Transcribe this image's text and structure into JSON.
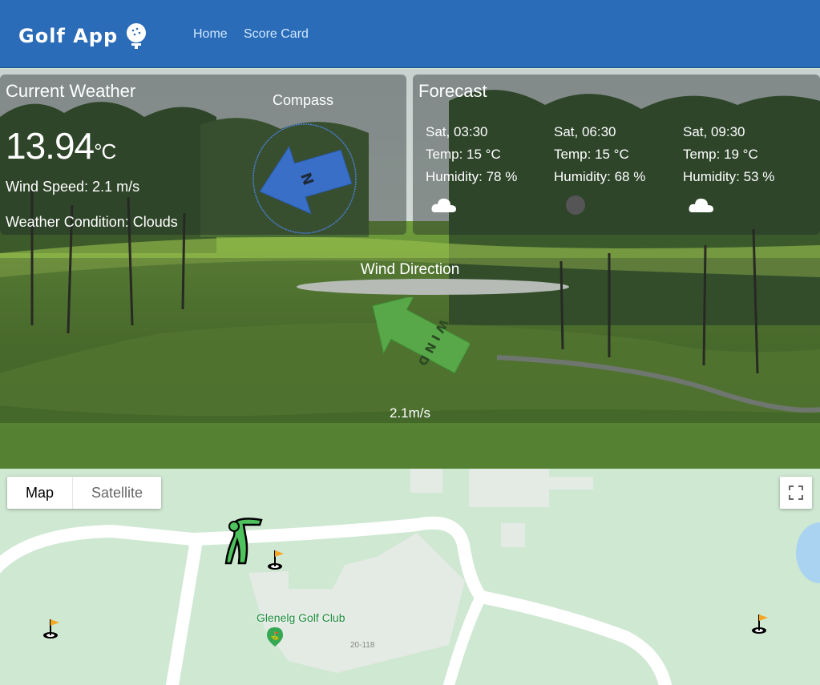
{
  "navbar": {
    "brand": "Golf App",
    "links": [
      {
        "label": "Home"
      },
      {
        "label": "Score Card"
      }
    ]
  },
  "weather": {
    "title": "Current Weather",
    "temp_value": "13.94",
    "temp_unit": "°C",
    "wind_speed": "Wind Speed: 2.1 m/s",
    "condition": "Weather Condition: Clouds",
    "compass_label": "Compass",
    "compass_letter": "N"
  },
  "forecast": {
    "title": "Forecast",
    "items": [
      {
        "time": "Sat, 03:30",
        "temp": "Temp: 15 °C",
        "humidity": "Humidity: 78 %",
        "icon": "cloud-icon"
      },
      {
        "time": "Sat, 06:30",
        "temp": "Temp: 15 °C",
        "humidity": "Humidity: 68 %",
        "icon": "dark-cloud-icon"
      },
      {
        "time": "Sat, 09:30",
        "temp": "Temp: 19 °C",
        "humidity": "Humidity: 53 %",
        "icon": "cloud-icon"
      }
    ]
  },
  "wind": {
    "title": "Wind Direction",
    "arrow_text": "W I N D",
    "speed": "2.1m/s"
  },
  "map": {
    "map_button": "Map",
    "satellite_button": "Satellite",
    "place_name": "Glenelg Golf Club",
    "road_number": "20-118"
  },
  "colors": {
    "navbar": "#2b6cb8",
    "compass_arrow": "#3a6fc8",
    "wind_arrow": "#58a84a"
  }
}
